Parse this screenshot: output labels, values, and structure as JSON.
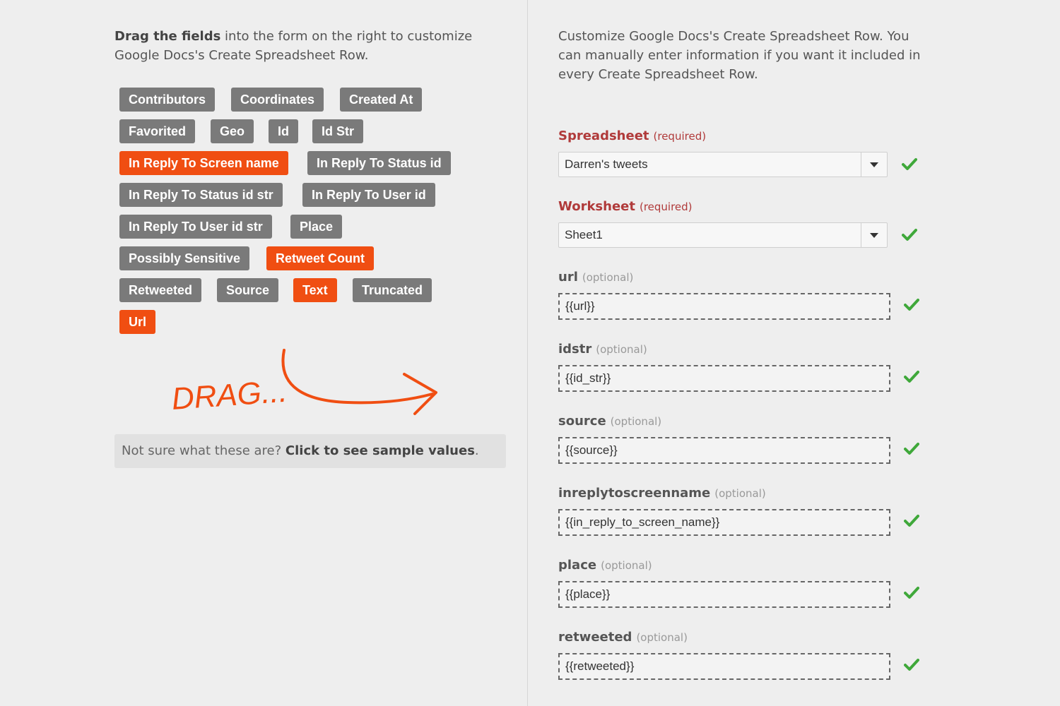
{
  "left": {
    "intro_bold": "Drag the fields",
    "intro_rest": " into the form on the right to customize Google Docs's Create Spreadsheet Row.",
    "chips": [
      {
        "label": "Contributors",
        "active": false
      },
      {
        "label": "Coordinates",
        "active": false
      },
      {
        "label": "Created At",
        "active": false
      },
      {
        "label": "Favorited",
        "active": false
      },
      {
        "label": "Geo",
        "active": false
      },
      {
        "label": "Id",
        "active": false
      },
      {
        "label": "Id Str",
        "active": false
      },
      {
        "label": "In Reply To Screen name",
        "active": true
      },
      {
        "label": "In Reply To Status id",
        "active": false
      },
      {
        "label": "In Reply To Status id str",
        "active": false
      },
      {
        "label": "In Reply To User id",
        "active": false
      },
      {
        "label": "In Reply To User id str",
        "active": false
      },
      {
        "label": "Place",
        "active": false
      },
      {
        "label": "Possibly Sensitive",
        "active": false
      },
      {
        "label": "Retweet Count",
        "active": true
      },
      {
        "label": "Retweeted",
        "active": false
      },
      {
        "label": "Source",
        "active": false
      },
      {
        "label": "Text",
        "active": true
      },
      {
        "label": "Truncated",
        "active": false
      },
      {
        "label": "Url",
        "active": true
      }
    ],
    "drag_text": "DRAG...",
    "sample_prefix": "Not sure what these are? ",
    "sample_link": "Click to see sample values",
    "sample_suffix": "."
  },
  "right": {
    "intro": "Customize Google Docs's Create Spreadsheet Row. You can manually enter information if you want it included in every Create Spreadsheet Row.",
    "selects": [
      {
        "label": "Spreadsheet",
        "hint": "(required)",
        "value": "Darren's tweets"
      },
      {
        "label": "Worksheet",
        "hint": "(required)",
        "value": "Sheet1"
      }
    ],
    "fields": [
      {
        "label": "url",
        "hint": "(optional)",
        "value": "{{url}}"
      },
      {
        "label": "idstr",
        "hint": "(optional)",
        "value": "{{id_str}}"
      },
      {
        "label": "source",
        "hint": "(optional)",
        "value": "{{source}}"
      },
      {
        "label": "inreplytoscreenname",
        "hint": "(optional)",
        "value": "{{in_reply_to_screen_name}}"
      },
      {
        "label": "place",
        "hint": "(optional)",
        "value": "{{place}}"
      },
      {
        "label": "retweeted",
        "hint": "(optional)",
        "value": "{{retweeted}}"
      }
    ]
  },
  "colors": {
    "accent": "#f04e12",
    "chip_gray": "#7a7a7a",
    "required_red": "#b03a3a",
    "check_green": "#3fa83a"
  }
}
